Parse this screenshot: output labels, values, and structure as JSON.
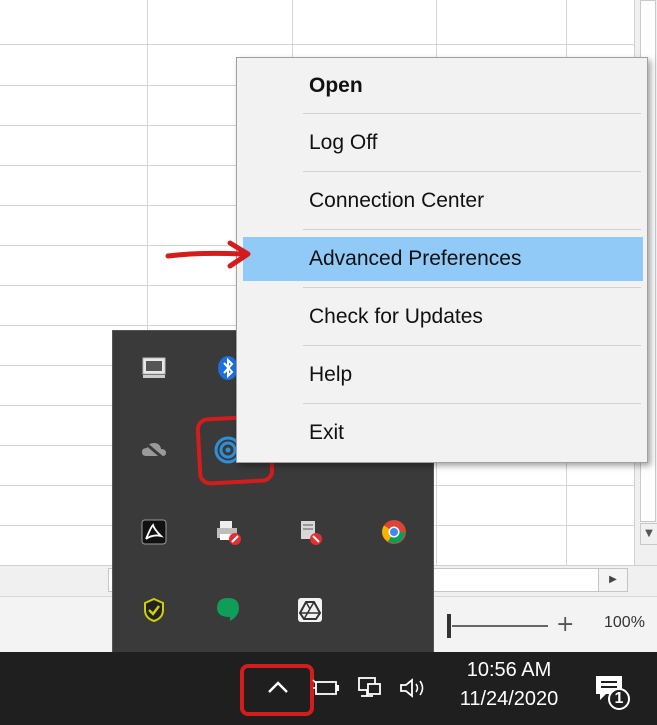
{
  "context_menu": {
    "items": [
      {
        "label": "Open",
        "bold": true
      },
      {
        "label": "Log Off"
      },
      {
        "label": "Connection Center"
      },
      {
        "label": "Advanced Preferences",
        "highlighted": true
      },
      {
        "label": "Check for Updates"
      },
      {
        "label": "Help"
      },
      {
        "label": "Exit"
      }
    ]
  },
  "tray_icons": [
    "touchpad-icon",
    "bluetooth-icon",
    "onedrive-icon",
    "citrix-workspace-icon",
    "acrobat-icon",
    "printer-error-icon",
    "app-error-icon",
    "chrome-icon",
    "security-shield-icon",
    "hangouts-icon",
    "google-drive-icon"
  ],
  "excel": {
    "zoom_label": "100%"
  },
  "taskbar": {
    "time": "10:56 AM",
    "date": "11/24/2020",
    "notification_count": "1"
  },
  "colors": {
    "menu_highlight": "#91c9f7",
    "annotation_red": "#d31d1d",
    "taskbar_bg": "#1f1f1f",
    "flyout_bg": "#3a3a3a"
  }
}
